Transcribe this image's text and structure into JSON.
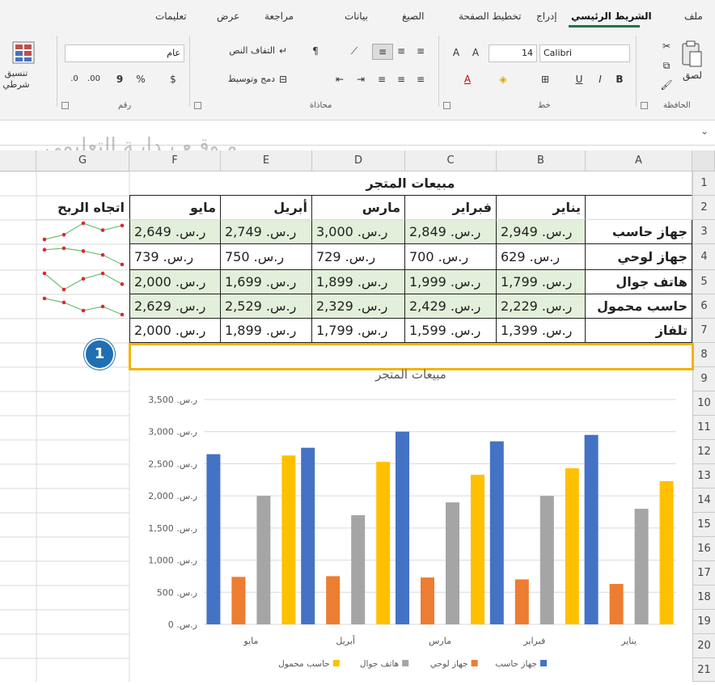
{
  "ribbon": {
    "tabs": [
      {
        "label": "ملف",
        "active": false
      },
      {
        "label": "الشريط الرئيسي",
        "active": true
      },
      {
        "label": "إدراج",
        "active": false
      },
      {
        "label": "تخطيط الصفحة",
        "active": false
      },
      {
        "label": "الصيغ",
        "active": false
      },
      {
        "label": "بيانات",
        "active": false
      },
      {
        "label": "مراجعة",
        "active": false
      },
      {
        "label": "عرض",
        "active": false
      },
      {
        "label": "تعليمات",
        "active": false
      }
    ],
    "clipboard": {
      "paste_label": "لصق",
      "group_label": "الحافظة"
    },
    "font": {
      "font_name": "Calibri",
      "font_size": "14",
      "group_label": "خط",
      "bold": "B",
      "italic": "I",
      "underline": "U"
    },
    "alignment": {
      "wrap_label": "التفاف النص",
      "merge_label": "دمج وتوسيط",
      "group_label": "محاذاة"
    },
    "number": {
      "format_value": "عام",
      "group_label": "رقم",
      "currency": "$",
      "percent": "%",
      "comma": "9"
    },
    "styles": {
      "conditional_label": "تنسيق شرطي"
    }
  },
  "watermark": "مـوقـع بـدايـة التعليمي",
  "columns": [
    "A",
    "B",
    "C",
    "D",
    "E",
    "F",
    "G"
  ],
  "rows": [
    "1",
    "2",
    "3",
    "4",
    "5",
    "6",
    "7",
    "8",
    "9",
    "10",
    "11",
    "12",
    "13",
    "14",
    "15",
    "16",
    "17",
    "18",
    "19",
    "20",
    "21"
  ],
  "sheet": {
    "title": "مبيعات المتجر",
    "month_headers": [
      "يناير",
      "فبراير",
      "مارس",
      "أبريل",
      "مايو"
    ],
    "trend_header": "اتجاه الربح",
    "products": [
      {
        "name": "جهاز حاسب",
        "values": [
          "ر.س. 2,949",
          "ر.س. 2,849",
          "ر.س. 3,000",
          "ر.س. 2,749",
          "ر.س. 2,649"
        ]
      },
      {
        "name": "جهاز لوحي",
        "values": [
          "ر.س. 629",
          "ر.س. 700",
          "ر.س. 729",
          "ر.س. 750",
          "ر.س. 739"
        ]
      },
      {
        "name": "هاتف جوال",
        "values": [
          "ر.س. 1,799",
          "ر.س. 1,999",
          "ر.س. 1,899",
          "ر.س. 1,699",
          "ر.س. 2,000"
        ]
      },
      {
        "name": "حاسب محمول",
        "values": [
          "ر.س. 2,229",
          "ر.س. 2,429",
          "ر.س. 2,329",
          "ر.س. 2,529",
          "ر.س. 2,629"
        ]
      },
      {
        "name": "تلفاز",
        "values": [
          "ر.س. 1,399",
          "ر.س. 1,599",
          "ر.س. 1,799",
          "ر.س. 1,899",
          "ر.س. 2,000"
        ]
      }
    ]
  },
  "sparklines": [
    [
      2949,
      2849,
      3000,
      2749,
      2649
    ],
    [
      629,
      700,
      729,
      750,
      739
    ],
    [
      1799,
      1999,
      1899,
      1699,
      2000
    ],
    [
      2229,
      2429,
      2329,
      2529,
      2629
    ]
  ],
  "callout": "1",
  "colors": {
    "accent": "#217346",
    "highlight": "#f2b400",
    "callout": "#1f6fb2",
    "green_fill": "#e2efda"
  },
  "chart_data": {
    "type": "bar",
    "title": "مبيعات المتجر",
    "categories": [
      "يناير",
      "فبراير",
      "مارس",
      "أبريل",
      "مايو"
    ],
    "ylim": [
      0,
      3500
    ],
    "yticks": [
      "ر.س. 0",
      "ر.س. 500",
      "ر.س. 1,000",
      "ر.س. 1,500",
      "ر.س. 2,000",
      "ر.س. 2,500",
      "ر.س. 3,000",
      "ر.س. 3,500"
    ],
    "ytick_values": [
      0,
      500,
      1000,
      1500,
      2000,
      2500,
      3000,
      3500
    ],
    "grid": true,
    "legend_position": "bottom",
    "series": [
      {
        "name": "جهاز حاسب",
        "color": "#4472c4",
        "values": [
          2949,
          2849,
          3000,
          2749,
          2649
        ]
      },
      {
        "name": "جهاز لوحي",
        "color": "#ed7d31",
        "values": [
          629,
          700,
          729,
          750,
          739
        ]
      },
      {
        "name": "هاتف جوال",
        "color": "#a5a5a5",
        "values": [
          1799,
          1999,
          1899,
          1699,
          2000
        ]
      },
      {
        "name": "حاسب محمول",
        "color": "#ffc000",
        "values": [
          2229,
          2429,
          2329,
          2529,
          2629
        ]
      }
    ]
  }
}
